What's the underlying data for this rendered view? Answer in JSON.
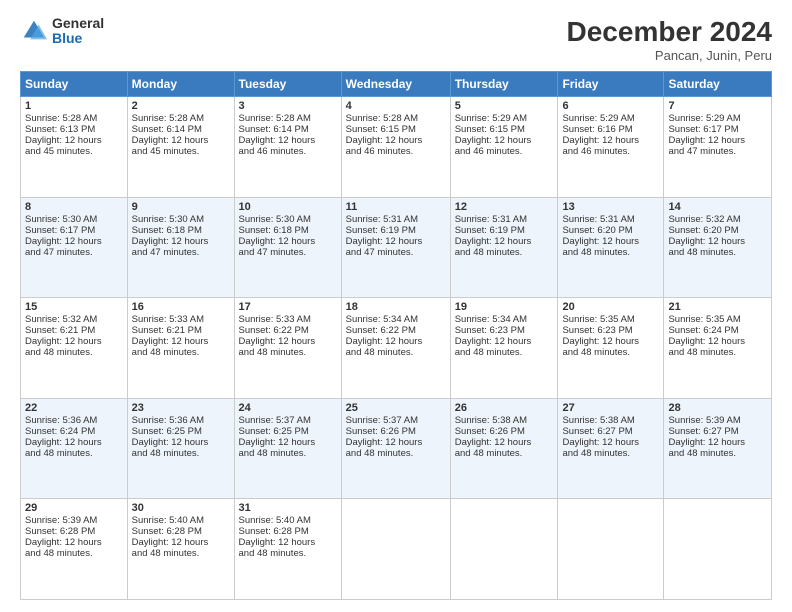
{
  "header": {
    "logo_general": "General",
    "logo_blue": "Blue",
    "title": "December 2024",
    "subtitle": "Pancan, Junin, Peru"
  },
  "days_of_week": [
    "Sunday",
    "Monday",
    "Tuesday",
    "Wednesday",
    "Thursday",
    "Friday",
    "Saturday"
  ],
  "weeks": [
    [
      {
        "day": "1",
        "sunrise": "5:28 AM",
        "sunset": "6:13 PM",
        "daylight": "12 hours and 45 minutes."
      },
      {
        "day": "2",
        "sunrise": "5:28 AM",
        "sunset": "6:14 PM",
        "daylight": "12 hours and 45 minutes."
      },
      {
        "day": "3",
        "sunrise": "5:28 AM",
        "sunset": "6:14 PM",
        "daylight": "12 hours and 46 minutes."
      },
      {
        "day": "4",
        "sunrise": "5:28 AM",
        "sunset": "6:15 PM",
        "daylight": "12 hours and 46 minutes."
      },
      {
        "day": "5",
        "sunrise": "5:29 AM",
        "sunset": "6:15 PM",
        "daylight": "12 hours and 46 minutes."
      },
      {
        "day": "6",
        "sunrise": "5:29 AM",
        "sunset": "6:16 PM",
        "daylight": "12 hours and 46 minutes."
      },
      {
        "day": "7",
        "sunrise": "5:29 AM",
        "sunset": "6:17 PM",
        "daylight": "12 hours and 47 minutes."
      }
    ],
    [
      {
        "day": "8",
        "sunrise": "5:30 AM",
        "sunset": "6:17 PM",
        "daylight": "12 hours and 47 minutes."
      },
      {
        "day": "9",
        "sunrise": "5:30 AM",
        "sunset": "6:18 PM",
        "daylight": "12 hours and 47 minutes."
      },
      {
        "day": "10",
        "sunrise": "5:30 AM",
        "sunset": "6:18 PM",
        "daylight": "12 hours and 47 minutes."
      },
      {
        "day": "11",
        "sunrise": "5:31 AM",
        "sunset": "6:19 PM",
        "daylight": "12 hours and 47 minutes."
      },
      {
        "day": "12",
        "sunrise": "5:31 AM",
        "sunset": "6:19 PM",
        "daylight": "12 hours and 48 minutes."
      },
      {
        "day": "13",
        "sunrise": "5:31 AM",
        "sunset": "6:20 PM",
        "daylight": "12 hours and 48 minutes."
      },
      {
        "day": "14",
        "sunrise": "5:32 AM",
        "sunset": "6:20 PM",
        "daylight": "12 hours and 48 minutes."
      }
    ],
    [
      {
        "day": "15",
        "sunrise": "5:32 AM",
        "sunset": "6:21 PM",
        "daylight": "12 hours and 48 minutes."
      },
      {
        "day": "16",
        "sunrise": "5:33 AM",
        "sunset": "6:21 PM",
        "daylight": "12 hours and 48 minutes."
      },
      {
        "day": "17",
        "sunrise": "5:33 AM",
        "sunset": "6:22 PM",
        "daylight": "12 hours and 48 minutes."
      },
      {
        "day": "18",
        "sunrise": "5:34 AM",
        "sunset": "6:22 PM",
        "daylight": "12 hours and 48 minutes."
      },
      {
        "day": "19",
        "sunrise": "5:34 AM",
        "sunset": "6:23 PM",
        "daylight": "12 hours and 48 minutes."
      },
      {
        "day": "20",
        "sunrise": "5:35 AM",
        "sunset": "6:23 PM",
        "daylight": "12 hours and 48 minutes."
      },
      {
        "day": "21",
        "sunrise": "5:35 AM",
        "sunset": "6:24 PM",
        "daylight": "12 hours and 48 minutes."
      }
    ],
    [
      {
        "day": "22",
        "sunrise": "5:36 AM",
        "sunset": "6:24 PM",
        "daylight": "12 hours and 48 minutes."
      },
      {
        "day": "23",
        "sunrise": "5:36 AM",
        "sunset": "6:25 PM",
        "daylight": "12 hours and 48 minutes."
      },
      {
        "day": "24",
        "sunrise": "5:37 AM",
        "sunset": "6:25 PM",
        "daylight": "12 hours and 48 minutes."
      },
      {
        "day": "25",
        "sunrise": "5:37 AM",
        "sunset": "6:26 PM",
        "daylight": "12 hours and 48 minutes."
      },
      {
        "day": "26",
        "sunrise": "5:38 AM",
        "sunset": "6:26 PM",
        "daylight": "12 hours and 48 minutes."
      },
      {
        "day": "27",
        "sunrise": "5:38 AM",
        "sunset": "6:27 PM",
        "daylight": "12 hours and 48 minutes."
      },
      {
        "day": "28",
        "sunrise": "5:39 AM",
        "sunset": "6:27 PM",
        "daylight": "12 hours and 48 minutes."
      }
    ],
    [
      {
        "day": "29",
        "sunrise": "5:39 AM",
        "sunset": "6:28 PM",
        "daylight": "12 hours and 48 minutes."
      },
      {
        "day": "30",
        "sunrise": "5:40 AM",
        "sunset": "6:28 PM",
        "daylight": "12 hours and 48 minutes."
      },
      {
        "day": "31",
        "sunrise": "5:40 AM",
        "sunset": "6:28 PM",
        "daylight": "12 hours and 48 minutes."
      },
      null,
      null,
      null,
      null
    ]
  ],
  "labels": {
    "sunrise": "Sunrise: ",
    "sunset": "Sunset: ",
    "daylight": "Daylight: "
  }
}
